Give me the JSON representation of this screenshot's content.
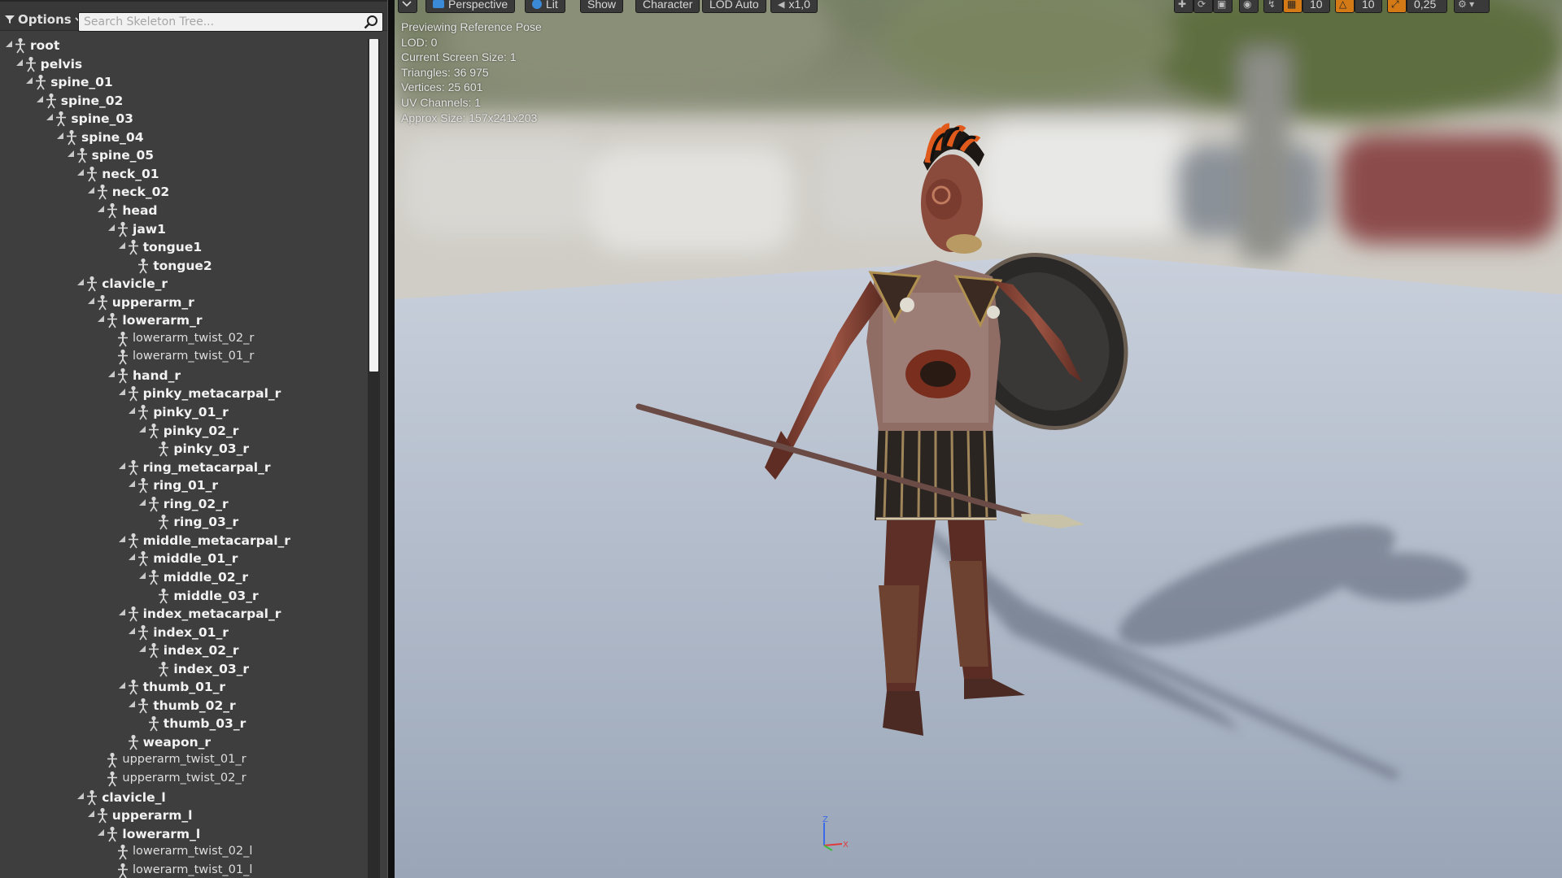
{
  "tree_toolbar": {
    "options_label": "Options",
    "search_placeholder": "Search Skeleton Tree..."
  },
  "bones": [
    {
      "name": "root",
      "depth": 0,
      "expand": "open",
      "style": "bold"
    },
    {
      "name": "pelvis",
      "depth": 1,
      "expand": "open",
      "style": "bold"
    },
    {
      "name": "spine_01",
      "depth": 2,
      "expand": "open",
      "style": "bold"
    },
    {
      "name": "spine_02",
      "depth": 3,
      "expand": "open",
      "style": "bold"
    },
    {
      "name": "spine_03",
      "depth": 4,
      "expand": "open",
      "style": "bold"
    },
    {
      "name": "spine_04",
      "depth": 5,
      "expand": "open",
      "style": "bold"
    },
    {
      "name": "spine_05",
      "depth": 6,
      "expand": "open",
      "style": "bold"
    },
    {
      "name": "neck_01",
      "depth": 7,
      "expand": "open",
      "style": "bold"
    },
    {
      "name": "neck_02",
      "depth": 8,
      "expand": "open",
      "style": "bold"
    },
    {
      "name": "head",
      "depth": 9,
      "expand": "open",
      "style": "bold"
    },
    {
      "name": "jaw1",
      "depth": 10,
      "expand": "open",
      "style": "bold"
    },
    {
      "name": "tongue1",
      "depth": 11,
      "expand": "open",
      "style": "bold"
    },
    {
      "name": "tongue2",
      "depth": 12,
      "expand": "none",
      "style": "bold"
    },
    {
      "name": "clavicle_r",
      "depth": 7,
      "expand": "open",
      "style": "bold"
    },
    {
      "name": "upperarm_r",
      "depth": 8,
      "expand": "open",
      "style": "bold"
    },
    {
      "name": "lowerarm_r",
      "depth": 9,
      "expand": "open",
      "style": "bold"
    },
    {
      "name": "lowerarm_twist_02_r",
      "depth": 10,
      "expand": "none",
      "style": "light"
    },
    {
      "name": "lowerarm_twist_01_r",
      "depth": 10,
      "expand": "none",
      "style": "light"
    },
    {
      "name": "hand_r",
      "depth": 10,
      "expand": "open",
      "style": "bold"
    },
    {
      "name": "pinky_metacarpal_r",
      "depth": 11,
      "expand": "open",
      "style": "bold"
    },
    {
      "name": "pinky_01_r",
      "depth": 12,
      "expand": "open",
      "style": "bold"
    },
    {
      "name": "pinky_02_r",
      "depth": 13,
      "expand": "open",
      "style": "bold"
    },
    {
      "name": "pinky_03_r",
      "depth": 14,
      "expand": "none",
      "style": "bold"
    },
    {
      "name": "ring_metacarpal_r",
      "depth": 11,
      "expand": "open",
      "style": "bold"
    },
    {
      "name": "ring_01_r",
      "depth": 12,
      "expand": "open",
      "style": "bold"
    },
    {
      "name": "ring_02_r",
      "depth": 13,
      "expand": "open",
      "style": "bold"
    },
    {
      "name": "ring_03_r",
      "depth": 14,
      "expand": "none",
      "style": "bold"
    },
    {
      "name": "middle_metacarpal_r",
      "depth": 11,
      "expand": "open",
      "style": "bold"
    },
    {
      "name": "middle_01_r",
      "depth": 12,
      "expand": "open",
      "style": "bold"
    },
    {
      "name": "middle_02_r",
      "depth": 13,
      "expand": "open",
      "style": "bold"
    },
    {
      "name": "middle_03_r",
      "depth": 14,
      "expand": "none",
      "style": "bold"
    },
    {
      "name": "index_metacarpal_r",
      "depth": 11,
      "expand": "open",
      "style": "bold"
    },
    {
      "name": "index_01_r",
      "depth": 12,
      "expand": "open",
      "style": "bold"
    },
    {
      "name": "index_02_r",
      "depth": 13,
      "expand": "open",
      "style": "bold"
    },
    {
      "name": "index_03_r",
      "depth": 14,
      "expand": "none",
      "style": "bold"
    },
    {
      "name": "thumb_01_r",
      "depth": 11,
      "expand": "open",
      "style": "bold"
    },
    {
      "name": "thumb_02_r",
      "depth": 12,
      "expand": "open",
      "style": "bold"
    },
    {
      "name": "thumb_03_r",
      "depth": 13,
      "expand": "none",
      "style": "bold"
    },
    {
      "name": "weapon_r",
      "depth": 11,
      "expand": "none",
      "style": "bold"
    },
    {
      "name": "upperarm_twist_01_r",
      "depth": 9,
      "expand": "none",
      "style": "light"
    },
    {
      "name": "upperarm_twist_02_r",
      "depth": 9,
      "expand": "none",
      "style": "light"
    },
    {
      "name": "clavicle_l",
      "depth": 7,
      "expand": "open",
      "style": "bold"
    },
    {
      "name": "upperarm_l",
      "depth": 8,
      "expand": "open",
      "style": "bold"
    },
    {
      "name": "lowerarm_l",
      "depth": 9,
      "expand": "open",
      "style": "bold"
    },
    {
      "name": "lowerarm_twist_02_l",
      "depth": 10,
      "expand": "none",
      "style": "light"
    },
    {
      "name": "lowerarm_twist_01_l",
      "depth": 10,
      "expand": "none",
      "style": "light"
    }
  ],
  "viewport_toolbar": {
    "perspective": "Perspective",
    "lit": "Lit",
    "show": "Show",
    "character": "Character",
    "lod": "LOD Auto",
    "speed": "x1,0",
    "grid_value": "10",
    "angle_value": "10",
    "scale_value": "0,25"
  },
  "stats": {
    "mode": "Previewing Reference Pose",
    "lod": "LOD: 0",
    "screen_size": "Current Screen Size: 1",
    "triangles": "Triangles: 36 975",
    "vertices": "Vertices: 25 601",
    "uv_channels": "UV Channels: 1",
    "approx_size": "Approx Size: 157x241x203"
  },
  "gizmo": {
    "x": "X",
    "z": "Z"
  },
  "colors": {
    "panel_bg": "#3e3e3e",
    "floor": "#a9b3c3",
    "accent_orange": "#e38b1a"
  }
}
